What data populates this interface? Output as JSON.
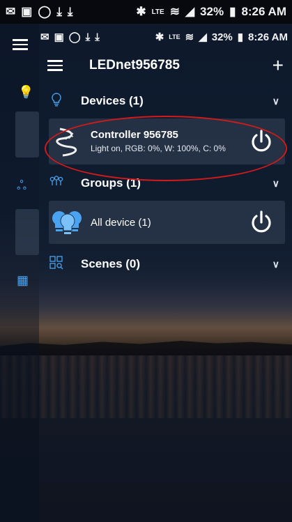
{
  "outer_status": {
    "battery": "32%",
    "time": "8:26 AM",
    "network": "LTE"
  },
  "inner_status": {
    "battery": "32%",
    "time": "8:26 AM",
    "network": "LTE"
  },
  "app": {
    "title": "LEDnet956785",
    "add_icon": "plus-icon",
    "menu_icon": "menu-icon"
  },
  "sections": {
    "devices": {
      "label": "Devices (1)",
      "icon": "bulb-outline-icon"
    },
    "groups": {
      "label": "Groups (1)",
      "icon": "group-icon"
    },
    "scenes": {
      "label": "Scenes (0)",
      "icon": "scenes-icon"
    }
  },
  "device": {
    "name": "Controller  956785",
    "status": "Light on, RGB: 0%, W: 100%, C: 0%"
  },
  "group": {
    "name": "All device (1)"
  },
  "colors": {
    "accent": "#4aa3f0",
    "highlight": "#d41a1a",
    "card": "#2e3a4e"
  }
}
